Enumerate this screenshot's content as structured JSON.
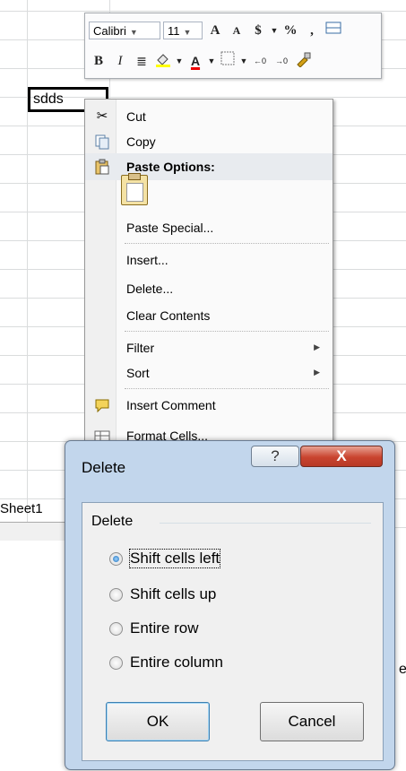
{
  "cell": {
    "value": "sdds"
  },
  "sheet": {
    "tab": "Sheet1"
  },
  "bg_fragment": "el",
  "mini_toolbar": {
    "font_name": "Calibri",
    "font_size": "11",
    "grow_font": "A",
    "shrink_font": "A",
    "currency": "$",
    "percent": "%",
    "comma": ",",
    "bold": "B",
    "italic": "I",
    "font_color": "A"
  },
  "context_menu": {
    "items": [
      {
        "label": "Cut",
        "icon": "scissors-icon"
      },
      {
        "label": "Copy",
        "icon": "copy-icon"
      },
      {
        "label": "Paste Options:",
        "icon": "paste-icon"
      },
      {
        "label": "Paste Special..."
      },
      {
        "label": "Insert..."
      },
      {
        "label": "Delete..."
      },
      {
        "label": "Clear Contents"
      },
      {
        "label": "Filter"
      },
      {
        "label": "Sort"
      },
      {
        "label": "Insert Comment",
        "icon": "comment-icon"
      },
      {
        "label": "Format Cells...",
        "icon": "format-cells-icon"
      }
    ]
  },
  "dialog": {
    "title": "Delete",
    "help": "?",
    "close": "X",
    "group": "Delete",
    "options": [
      {
        "label": "Shift cells left",
        "selected": true
      },
      {
        "label": "Shift cells up",
        "selected": false
      },
      {
        "label": "Entire row",
        "selected": false
      },
      {
        "label": "Entire column",
        "selected": false
      }
    ],
    "ok": "OK",
    "cancel": "Cancel"
  },
  "colors": {
    "close_button": "#c9442f",
    "dialog_frame": "#c2d6ec",
    "selection_border": "#000000"
  }
}
